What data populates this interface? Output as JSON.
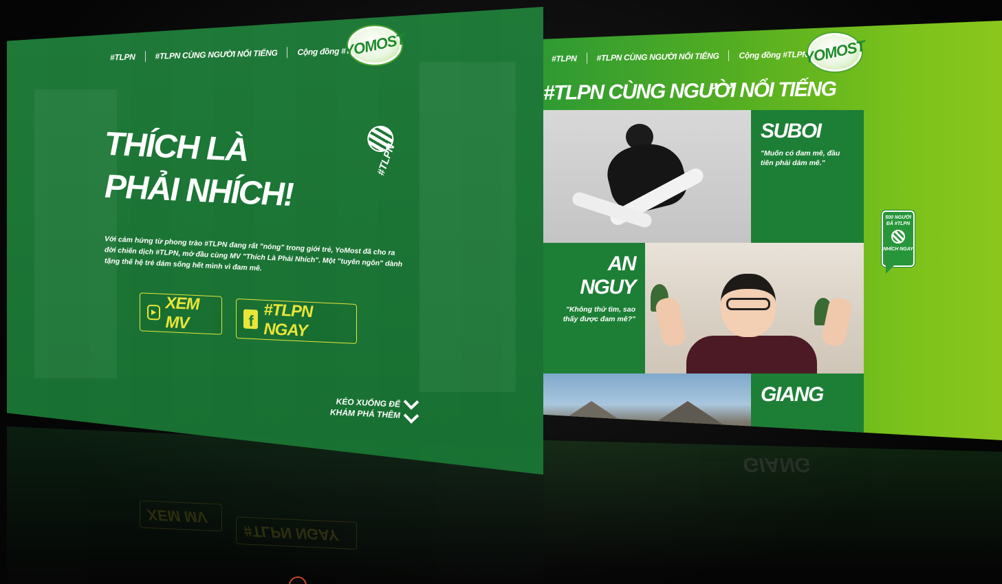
{
  "left_page": {
    "nav": {
      "item1": "#TLPN",
      "item2": "#TLPN CÙNG NGƯỜI NỔI TIẾNG",
      "item3": "Cộng đồng #TLPN"
    },
    "logo": "YOMOST",
    "hero_line1": "THÍCH LÀ",
    "hero_line2": "PHẢI NHÍCH!",
    "hashtag_icon": "#TLPN",
    "description": "Với cảm hứng từ phong trào #TLPN đang rất \"nóng\" trong giới trẻ, YoMost đã cho ra đời chiến dịch #TLPN, mở đầu cùng MV \"Thích Là Phải Nhích\". Một \"tuyên ngôn\" dành tặng thế hệ trẻ dám sống hết mình vì đam mê.",
    "buttons": {
      "watch_mv": "XEM MV",
      "tlpn_now": "#TLPN NGAY"
    },
    "scroll_hint_line1": "KÉO XUỐNG ĐỂ",
    "scroll_hint_line2": "KHÁM PHÁ THÊM",
    "accent_color": "#e8e63a",
    "brand_green": "#1e7a37"
  },
  "right_page": {
    "nav": {
      "item1": "#TLPN",
      "item2": "#TLPN CÙNG NGƯỜI NỔI TIẾNG",
      "item3": "Cộng đồng #TLPN"
    },
    "logo": "YOMOST",
    "section_title": "#TLPN CÙNG NGƯỜI NỔI TIẾNG",
    "celebs": [
      {
        "name": "SUBOI",
        "quote": "\"Muốn có đam mê, đầu tiên phải dám mê.\""
      },
      {
        "name": "AN NGUY",
        "quote": "\"Không thử tìm, sao thấy được đam mê?\""
      },
      {
        "name": "GIANG",
        "quote": ""
      }
    ],
    "badge": {
      "line1": "500 NGƯỜI",
      "line2": "ĐÃ #TLPN",
      "line3": "NHÍCH NGAY"
    }
  },
  "icons": [
    "youtube-icon",
    "facebook-icon",
    "heart-icon",
    "chevron-down-icon"
  ]
}
